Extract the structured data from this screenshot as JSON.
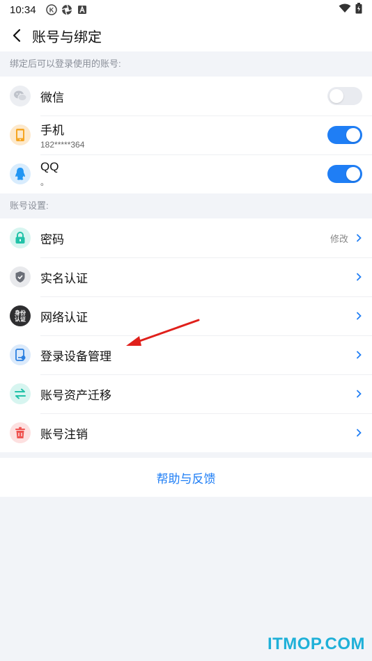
{
  "status_bar": {
    "time": "10:34"
  },
  "header": {
    "title": "账号与绑定"
  },
  "bind_section": {
    "label": "绑定后可以登录使用的账号:",
    "items": [
      {
        "label": "微信",
        "sub": "",
        "toggle": "off",
        "icon": "wechat-icon",
        "color": "#bfc3cb",
        "bg": "#eceef2"
      },
      {
        "label": "手机",
        "sub": "182*****364",
        "toggle": "on",
        "icon": "phone-icon",
        "color": "#f5a623",
        "bg": "#fde9cc"
      },
      {
        "label": "QQ",
        "sub": "。",
        "toggle": "on",
        "icon": "qq-icon",
        "color": "#2196f3",
        "bg": "#d8ecfd"
      }
    ]
  },
  "settings_section": {
    "label": "账号设置:",
    "items": [
      {
        "label": "密码",
        "value": "修改",
        "icon": "lock-icon"
      },
      {
        "label": "实名认证",
        "value": "",
        "icon": "shield-icon"
      },
      {
        "label": "网络认证",
        "value": "",
        "icon": "identity-badge-icon",
        "badge_text": "身份认证"
      },
      {
        "label": "登录设备管理",
        "value": "",
        "icon": "device-icon"
      },
      {
        "label": "账号资产迁移",
        "value": "",
        "icon": "transfer-icon"
      },
      {
        "label": "账号注销",
        "value": "",
        "icon": "trash-icon"
      }
    ]
  },
  "help": {
    "label": "帮助与反馈"
  },
  "watermark": "ITMOP.COM",
  "colors": {
    "accent": "#1f7ef5",
    "annotation": "#e0201b"
  }
}
